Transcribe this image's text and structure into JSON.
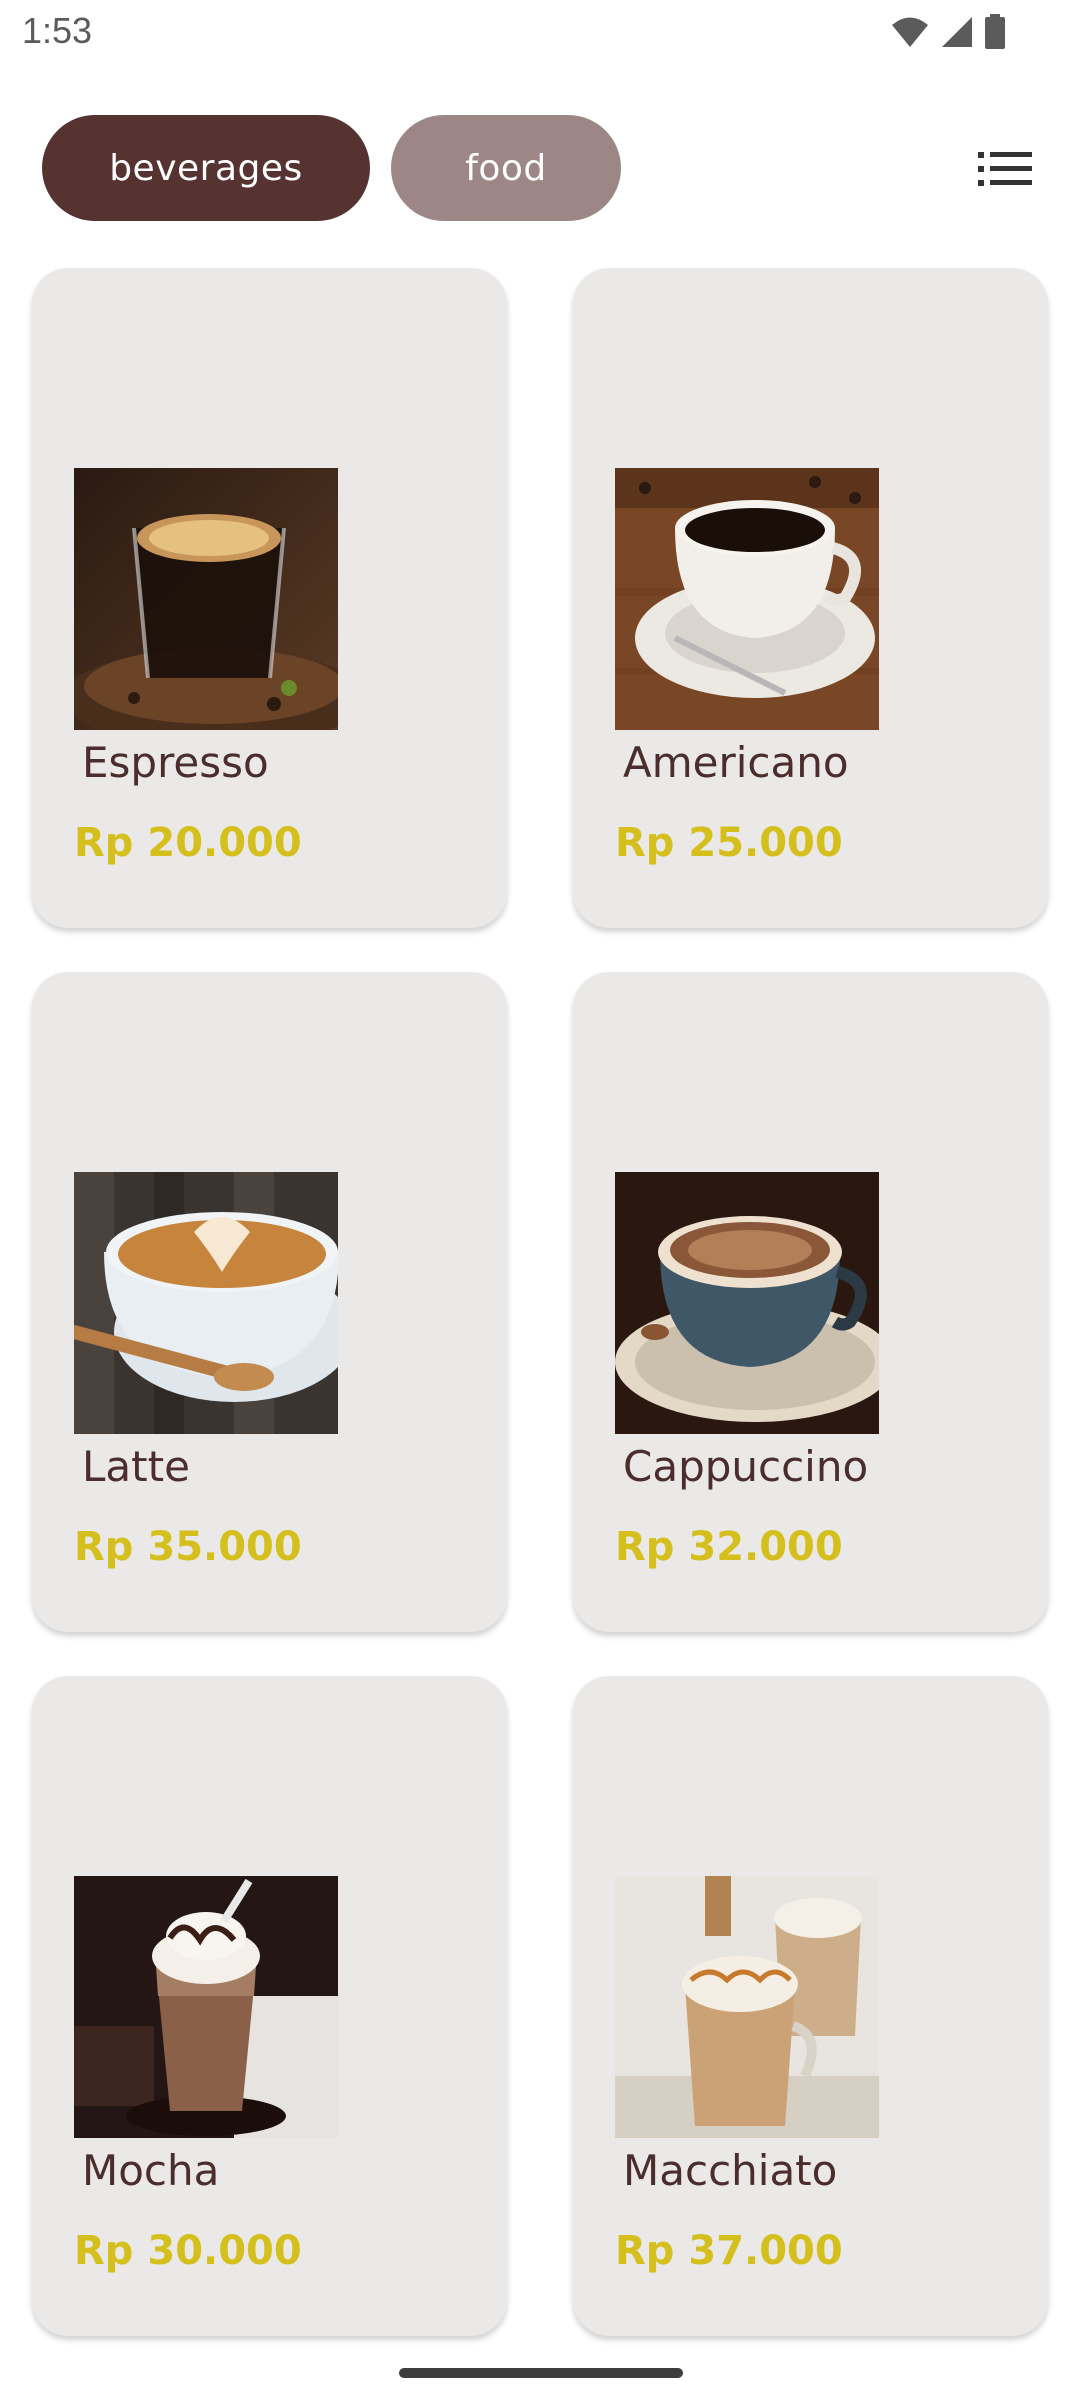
{
  "status_bar": {
    "time": "1:53",
    "icons": [
      "wifi-icon",
      "signal-icon",
      "battery-icon"
    ]
  },
  "categories": {
    "beverages_label": "beverages",
    "food_label": "food",
    "active": "beverages"
  },
  "colors": {
    "accent_active": "#563230",
    "accent_inactive": "#9c8686",
    "card_bg": "#ebe9e8",
    "name_color": "#4a2d2c",
    "price_color": "#d4bf1c"
  },
  "products": [
    {
      "name": "Espresso",
      "price": "Rp 20.000",
      "image": "espresso-photo"
    },
    {
      "name": "Americano",
      "price": "Rp 25.000",
      "image": "americano-photo"
    },
    {
      "name": "Latte",
      "price": "Rp 35.000",
      "image": "latte-photo"
    },
    {
      "name": "Cappuccino",
      "price": "Rp 32.000",
      "image": "cappuccino-photo"
    },
    {
      "name": "Mocha",
      "price": "Rp 30.000",
      "image": "mocha-photo"
    },
    {
      "name": "Macchiato",
      "price": "Rp 37.000",
      "image": "macchiato-photo"
    }
  ]
}
